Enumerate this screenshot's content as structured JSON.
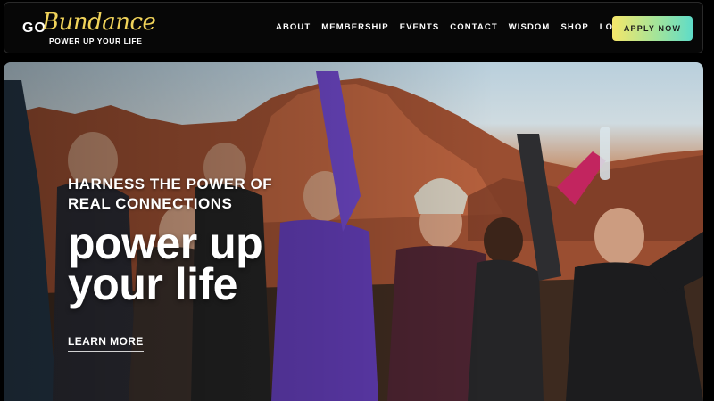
{
  "brand": {
    "logo_go": "GO",
    "logo_bundance": "Bundance",
    "logo_tagline": "POWER UP YOUR LIFE"
  },
  "nav": {
    "items": [
      "ABOUT",
      "MEMBERSHIP",
      "EVENTS",
      "CONTACT",
      "WISDOM",
      "SHOP",
      "LOGIN"
    ],
    "cta_label": "APPLY NOW"
  },
  "hero": {
    "kicker": "HARNESS THE POWER OF REAL CONNECTIONS",
    "headline": "power up your life",
    "cta_label": "LEARN MORE"
  },
  "colors": {
    "logo_gold": "#f0d35a",
    "header_bg": "#070707",
    "cta_gradient_start": "#f5e66a",
    "cta_gradient_end": "#5fdcc8"
  }
}
